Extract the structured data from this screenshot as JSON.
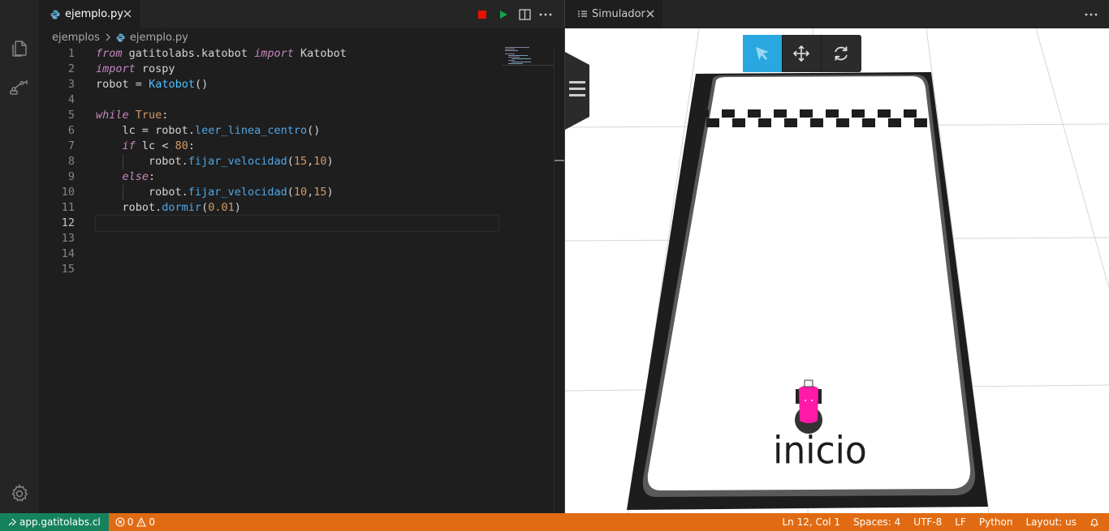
{
  "colors": {
    "editor_bg": "#1e1e1e",
    "sidebar_bg": "#252526",
    "statusbar_bg": "#e06b12",
    "remote_bg": "#16825d",
    "run_green": "#16a34a",
    "stop_red": "#e51400",
    "sim_tool_active": "#29a8e0",
    "robot_pink": "#ff1aa8"
  },
  "activity_bar": {
    "items": [
      {
        "icon": "files-icon"
      },
      {
        "icon": "robot-arm-icon"
      }
    ],
    "settings_icon": "gear-icon"
  },
  "editor": {
    "tab": {
      "label": "ejemplo.py",
      "icon": "python-file-icon"
    },
    "actions": [
      "stop-icon",
      "run-icon",
      "split-editor-icon",
      "more-icon"
    ],
    "breadcrumb": {
      "folder": "ejemplos",
      "file": "ejemplo.py"
    },
    "line_numbers": [
      "1",
      "2",
      "3",
      "4",
      "5",
      "6",
      "7",
      "8",
      "9",
      "10",
      "11",
      "12",
      "13",
      "14",
      "15"
    ],
    "active_line": 12,
    "code": {
      "l1": {
        "a": "from",
        "b": " gatitolabs.katobot ",
        "c": "import",
        "d": " Katobot"
      },
      "l2": {
        "a": "import",
        "b": " rospy"
      },
      "l3": {
        "a": "robot ",
        "b": "=",
        "c": " ",
        "d": "Katobot",
        "e": "()"
      },
      "l5": {
        "a": "while",
        "b": " ",
        "c": "True",
        "d": ":"
      },
      "l6": {
        "a": "    lc ",
        "b": "=",
        "c": " robot.",
        "d": "leer_linea_centro",
        "e": "()"
      },
      "l7": {
        "a": "    ",
        "b": "if",
        "c": " lc ",
        "d": "<",
        "e": " ",
        "f": "80",
        "g": ":"
      },
      "l8": {
        "a": "        robot.",
        "b": "fijar_velocidad",
        "c": "(",
        "d": "15",
        "e": ",",
        "f": "10",
        "g": ")"
      },
      "l9": {
        "a": "    ",
        "b": "else",
        "c": ":"
      },
      "l10": {
        "a": "        robot.",
        "b": "fijar_velocidad",
        "c": "(",
        "d": "10",
        "e": ",",
        "f": "15",
        "g": ")"
      },
      "l11": {
        "a": "    robot.",
        "b": "dormir",
        "c": "(",
        "d": "0.01",
        "e": ")"
      }
    }
  },
  "simulator": {
    "tab_label": "Simulador",
    "tools": [
      {
        "icon": "select-cursor-icon",
        "active": true
      },
      {
        "icon": "move-arrows-icon",
        "active": false
      },
      {
        "icon": "rotate-icon",
        "active": false
      }
    ],
    "track_start_label": "inicio"
  },
  "statusbar": {
    "remote": "app.gatitolabs.cl",
    "errors": "0",
    "warnings": "0",
    "position": "Ln 12, Col 1",
    "spaces": "Spaces: 4",
    "encoding": "UTF-8",
    "eol": "LF",
    "language": "Python",
    "layout": "Layout: us"
  }
}
